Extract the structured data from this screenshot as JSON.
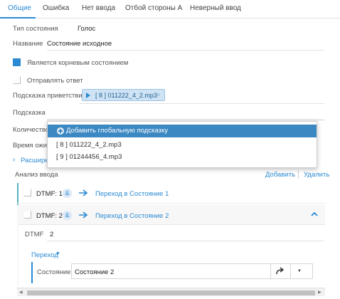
{
  "tabs": [
    {
      "label": "Общие",
      "active": true
    },
    {
      "label": "Ошибка"
    },
    {
      "label": "Нет ввода"
    },
    {
      "label": "Отбой стороны А"
    },
    {
      "label": "Неверный ввод"
    }
  ],
  "form": {
    "state_type_label": "Тип состояния",
    "state_type_value": "Голос",
    "name_label": "Название",
    "name_value": "Состояние исходное",
    "is_root_label": "Является корневым состоянием",
    "is_root_checked": true,
    "send_reply_label": "Отправлять ответ",
    "send_reply_checked": false,
    "greeting_hint_label": "Подсказка приветствия",
    "greeting_chip": "[ 8 ] 011222_4_2.mp3",
    "hint_label": "Подсказка",
    "count_label": "Количество",
    "wait_time_label": "Время ожид",
    "advanced_label": "Расшире"
  },
  "dropdown": {
    "items": [
      {
        "label": "Добавить глобальную подсказку",
        "highlight": true
      },
      {
        "label": "[ 8 ] 011222_4_2.mp3"
      },
      {
        "label": "[ 9 ] 01244456_4.mp3"
      }
    ]
  },
  "input_analysis": {
    "title": "Анализ ввода",
    "add_label": "Добавить",
    "delete_label": "Удалить",
    "rows": [
      {
        "dtmf": "DTMF: 1",
        "amp": "&",
        "link": "Переход в Состояние 1"
      },
      {
        "dtmf": "DTMF: 2",
        "amp": "&",
        "link": "Переход в Состояние 2"
      }
    ],
    "dtmf_field_label": "DTMF",
    "dtmf_field_value": "2",
    "transition_label": "Переход",
    "state_label": "Состояние",
    "state_value": "Состояние 2"
  },
  "colors": {
    "accent": "#2a8ad2",
    "highlight": "#3c88c3",
    "teal": "#5ab3c1"
  }
}
